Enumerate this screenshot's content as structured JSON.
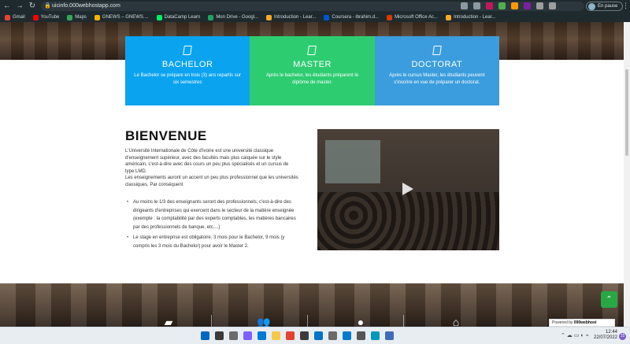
{
  "browser": {
    "url": "uicinfo.000webhostapp.com",
    "profile_label": "En pause",
    "bookmarks": [
      {
        "label": "Gmail",
        "color": "#ea4335"
      },
      {
        "label": "YouTube",
        "color": "#ff0000"
      },
      {
        "label": "Maps",
        "color": "#34a853"
      },
      {
        "label": "GNEWS – GNEWS....",
        "color": "#f4b400"
      },
      {
        "label": "DataCamp Learn",
        "color": "#03ef62"
      },
      {
        "label": "Mon Drive - Googl...",
        "color": "#1fa463"
      },
      {
        "label": "Introduction - Lear...",
        "color": "#f9a825"
      },
      {
        "label": "Coursera - ibrahim.d...",
        "color": "#0056d2"
      },
      {
        "label": "Microsoft Office Ac...",
        "color": "#d83b01"
      },
      {
        "label": "Introduction - Lear...",
        "color": "#f9a825"
      }
    ]
  },
  "cards": [
    {
      "title": "BACHELOR",
      "text": "Le Bachelor se prépare en trois (3) ans repartis sur six semestres",
      "color": "#0aa3f0"
    },
    {
      "title": "MASTER",
      "text": "Après le bachelor, les étudiants préparent le diplôme de master.",
      "color": "#2ecc71"
    },
    {
      "title": "DOCTORAT",
      "text": "Après le cursus Master, les étudiants peuvent s'inscrire en vue de préparer un doctorat.",
      "color": "#3b9ddd"
    }
  ],
  "welcome": {
    "title": "BIENVENUE",
    "paragraph1": "L'Université Internationale de Côte d'Ivoire est une université classique d'enseignement supérieur, avec des facultés mais plus calquée sur le style américain, c'est-à-dire avec des cours un peu plus spécialisés et un cursus de type LMD.",
    "paragraph2": "Les enseignements auront un accent un peu plus professionnel que les universités classiques. Par conséquent",
    "bullets": [
      "Au moins le 1/3 des enseignants seront des professionnels, c'est-à-dire des dirigeants d'entreprises qui exercent dans le secteur de la matière enseignée (exemple : la comptabilité par des experts comptables, les matières bancaires par des professionnels de banque, etc....)",
      "Le stage en entreprise est obligatoire. 3 mois pour le Bachelor, 9 mois (y compris les 3 mois du Bachelor) pour avoir le Master 2."
    ]
  },
  "powered_by": {
    "prefix": "Powered by",
    "brand": "000webhost"
  },
  "clock": {
    "time": "12:44",
    "date": "22/07/2022"
  },
  "notification_count": "15"
}
